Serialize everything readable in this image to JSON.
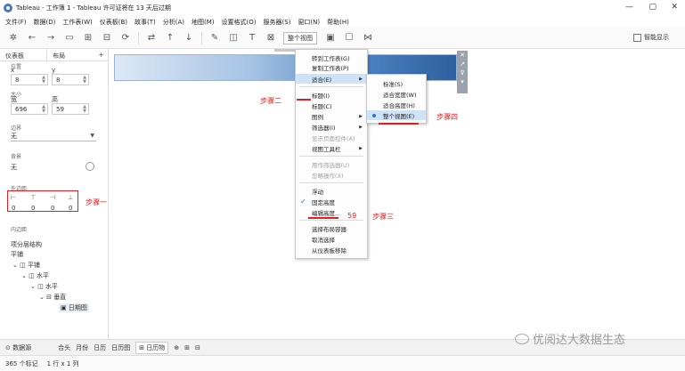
{
  "window": {
    "title": "Tableau - 工作簿 1 - Tableau 许可证将在 13 天后过期",
    "minimize": "—",
    "maximize": "▢",
    "close": "✕"
  },
  "menubar": [
    "文件(F)",
    "数据(D)",
    "工作表(W)",
    "仪表板(B)",
    "故事(T)",
    "分析(A)",
    "地图(M)",
    "设置格式(O)",
    "服务器(S)",
    "窗口(N)",
    "帮助(H)"
  ],
  "toolbar": {
    "view_select": "整个视图",
    "smart_show": "智能显示"
  },
  "leftpanel": {
    "tabs": [
      "仪表板",
      "布局"
    ],
    "plus": "+",
    "position_label": "位置",
    "x_label": "x",
    "y_label": "y",
    "x_value": "8",
    "y_value": "8",
    "size_label": "大小",
    "width_label": "宽",
    "height_label": "高",
    "width_value": "696",
    "height_value": "59",
    "border_label": "边界",
    "border_value": "无",
    "background_label": "背景",
    "background_value": "无",
    "outer_padding_label": "外边距",
    "padding_values": [
      "0",
      "0",
      "0",
      "0"
    ],
    "inner_padding_label": "内边距",
    "hierarchy_label": "项分层结构",
    "tree": [
      "平铺",
      "水平",
      "水平",
      "垂直",
      "日期图"
    ],
    "tree_root": "平铺"
  },
  "context_menu": {
    "items": [
      {
        "label": "转到工作表(G)",
        "disabled": false
      },
      {
        "label": "复制工作表(P)",
        "disabled": false
      },
      {
        "label": "适合(E)",
        "disabled": false,
        "submenu": true,
        "hover": true
      },
      {
        "label": "标题(I)",
        "disabled": false
      },
      {
        "label": "标题(C)",
        "disabled": false
      },
      {
        "label": "图例",
        "disabled": false,
        "submenu": true
      },
      {
        "label": "筛选器(I)",
        "disabled": false,
        "submenu": true
      },
      {
        "label": "显示页面控件(A)",
        "disabled": true
      },
      {
        "label": "视图工具栏",
        "disabled": false,
        "submenu": true
      },
      {
        "label": "用作筛选器(U)",
        "disabled": true
      },
      {
        "label": "忽略操作(X)",
        "disabled": true
      },
      {
        "label": "浮动",
        "disabled": false
      },
      {
        "label": "固定高度",
        "disabled": false,
        "checked": true
      },
      {
        "label": "编辑高度...",
        "disabled": false
      },
      {
        "label": "选择布局容器",
        "disabled": false
      },
      {
        "label": "取消选择",
        "disabled": false
      },
      {
        "label": "从仪表板移除",
        "disabled": false
      }
    ]
  },
  "submenu": {
    "items": [
      {
        "label": "标准(S)",
        "selected": false
      },
      {
        "label": "适合宽度(W)",
        "selected": false
      },
      {
        "label": "适合高度(H)",
        "selected": false
      },
      {
        "label": "整个视图(E)",
        "selected": true
      }
    ]
  },
  "annotations": {
    "step1": "步骤一",
    "step2": "步骤二",
    "step3": "步骤三",
    "step4": "步骤四",
    "value59": "59"
  },
  "bottombar": {
    "datasource": "数据源",
    "tabs": [
      "合头",
      "月份",
      "日历",
      "日历图",
      "日历物"
    ],
    "active_tab": "日历物"
  },
  "statusbar": {
    "marks": "365 个标记",
    "rowcol": "1 行 x 1 列"
  },
  "watermark": "优阅达大数据生态",
  "colors": {
    "accent": "#2e6fc7",
    "annotation": "#e02020",
    "hover": "#cfe3f8"
  }
}
